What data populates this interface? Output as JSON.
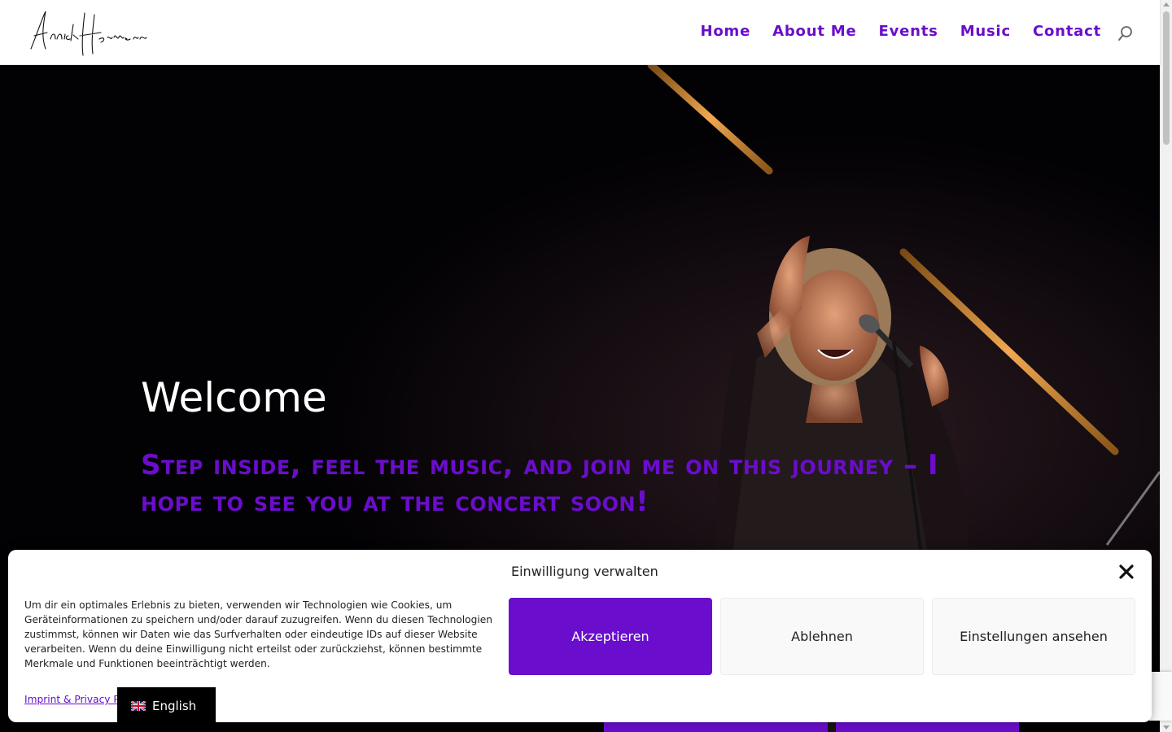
{
  "site": {
    "logo_text": "Annick Hermann"
  },
  "nav": {
    "items": [
      {
        "label": "Home"
      },
      {
        "label": "About Me"
      },
      {
        "label": "Events"
      },
      {
        "label": "Music"
      },
      {
        "label": "Contact"
      }
    ]
  },
  "icons": {
    "search": "search-icon",
    "close": "close-icon",
    "flag": "uk-flag-icon"
  },
  "hero": {
    "title": "Welcome",
    "subtitle": "Step inside, feel the music, and join me on this journey – I hope to see you at the concert soon!"
  },
  "cookie": {
    "title": "Einwilligung verwalten",
    "text": "Um dir ein optimales Erlebnis zu bieten, verwenden wir Technologien wie Cookies, um Geräteinformationen zu speichern und/oder darauf zuzugreifen. Wenn du diesen Technologien zustimmst, können wir Daten wie das Surfverhalten oder eindeutige IDs auf dieser Website verarbeiten. Wenn du deine Einwilligung nicht erteilst oder zurückziehst, können bestimmte Merkmale und Funktionen beeinträchtigt werden.",
    "link": "Imprint & Privacy Policy",
    "accept": "Akzeptieren",
    "deny": "Ablehnen",
    "settings": "Einstellungen ansehen"
  },
  "language": {
    "label": "English"
  },
  "colors": {
    "accent": "#6a0dcc",
    "hero_bg": "#020104",
    "white": "#ffffff",
    "light_button": "#f9f9f9"
  }
}
